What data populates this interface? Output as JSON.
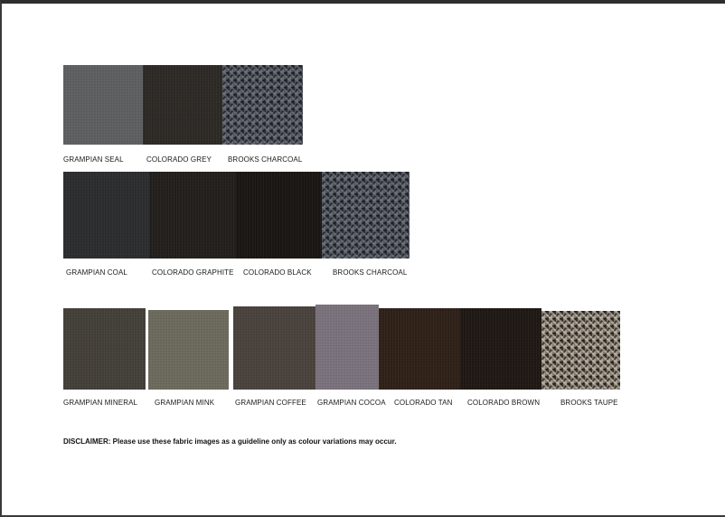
{
  "swatches": [
    {
      "label": "GRAMPIAN SEAL",
      "color": "#5e5f61",
      "pattern": "plain"
    },
    {
      "label": "COLORADO GREY",
      "color": "#2d2a26",
      "pattern": "plain"
    },
    {
      "label": "BROOKS CHARCOAL",
      "color": "#2a2d33",
      "pattern": "houndstooth"
    },
    {
      "label": "GRAMPIAN COAL",
      "color": "#2c2d2f",
      "pattern": "plain"
    },
    {
      "label": "COLORADO GRAPHITE",
      "color": "#221f1c",
      "pattern": "plain"
    },
    {
      "label": "COLORADO BLACK",
      "color": "#1a1614",
      "pattern": "plain"
    },
    {
      "label": "BROOKS CHARCOAL",
      "color": "#2a2d33",
      "pattern": "houndstooth"
    },
    {
      "label": "GRAMPIAN MINERAL",
      "color": "#444039",
      "pattern": "plain"
    },
    {
      "label": "GRAMPIAN MINK",
      "color": "#6b6a5c",
      "pattern": "plain"
    },
    {
      "label": "GRAMPIAN COFFEE",
      "color": "#4a423c",
      "pattern": "plain"
    },
    {
      "label": "GRAMPIAN COCOA",
      "color": "#7a727c",
      "pattern": "plain"
    },
    {
      "label": "COLORADO TAN",
      "color": "#2f2118",
      "pattern": "plain"
    },
    {
      "label": "COLORADO BROWN",
      "color": "#1f1814",
      "pattern": "plain"
    },
    {
      "label": "BROOKS TAUPE",
      "color": "#3b342c",
      "pattern": "houndstooth-light"
    }
  ],
  "disclaimer": "DISCLAIMER: Please use these fabric images as a guideline only as colour variations may occur."
}
